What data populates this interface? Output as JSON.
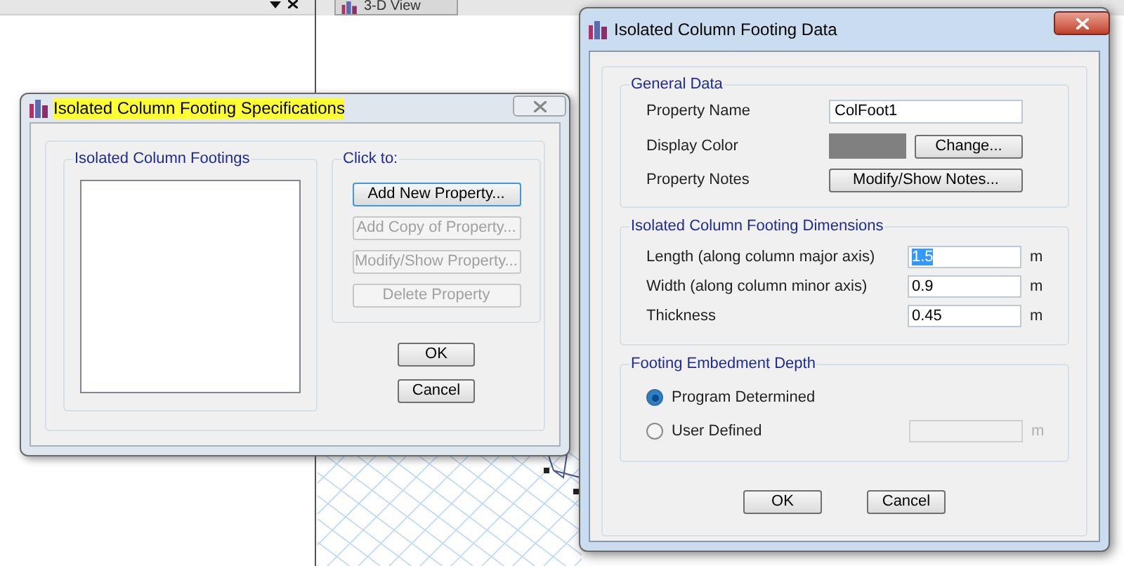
{
  "view_tab": {
    "label": "3-D View"
  },
  "specs_dialog": {
    "title": "Isolated Column Footing Specifications",
    "title_highlighted": true,
    "list_group": {
      "title": "Isolated Column Footings"
    },
    "actions_group": {
      "title": "Click to:",
      "buttons": [
        {
          "label": "Add New Property...",
          "disabled": false
        },
        {
          "label": "Add Copy of Property...",
          "disabled": true
        },
        {
          "label": "Modify/Show Property...",
          "disabled": true
        },
        {
          "label": "Delete Property",
          "disabled": true
        }
      ]
    },
    "buttons": [
      "OK",
      "Cancel"
    ]
  },
  "data_dialog": {
    "title": "Isolated Column Footing Data",
    "general": {
      "title": "General Data",
      "property_name": {
        "label": "Property Name",
        "value": "ColFoot1"
      },
      "display_color": {
        "label": "Display Color",
        "color": "#808080",
        "button": "Change..."
      },
      "property_notes": {
        "label": "Property Notes",
        "button": "Modify/Show Notes..."
      }
    },
    "dimensions": {
      "title": "Isolated Column Footing Dimensions",
      "rows": [
        {
          "label": "Length (along column major axis)",
          "value": "1.5",
          "unit": "m",
          "text_selected": true
        },
        {
          "label": "Width (along column minor axis)",
          "value": "0.9",
          "unit": "m",
          "text_selected": false
        },
        {
          "label": "Thickness",
          "value": "0.45",
          "unit": "m",
          "text_selected": false
        }
      ]
    },
    "embedment": {
      "title": "Footing Embedment Depth",
      "options": [
        {
          "label": "Program Determined",
          "selected": true
        },
        {
          "label": "User Defined",
          "selected": false
        }
      ],
      "user_value": {
        "unit": "m",
        "disabled": true
      }
    },
    "buttons": [
      "OK",
      "Cancel"
    ]
  }
}
